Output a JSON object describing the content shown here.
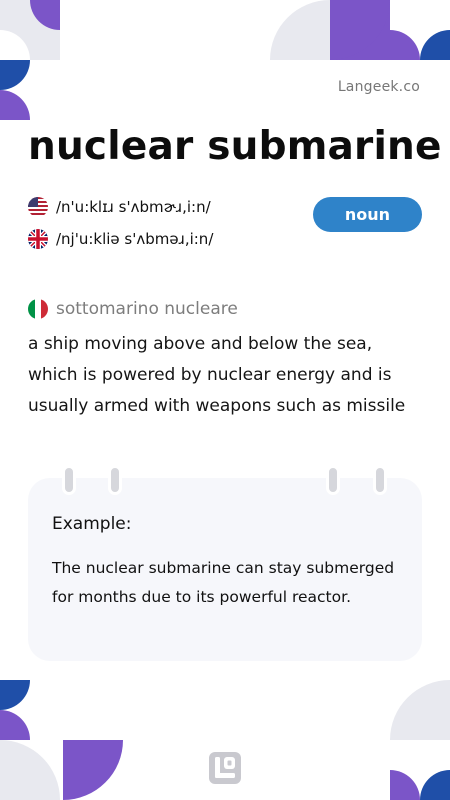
{
  "brand": {
    "label": "Langeek.co"
  },
  "entry": {
    "word": "nuclear submarine",
    "part_of_speech": "noun",
    "pronunciations": [
      {
        "accent": "us-flag",
        "ipa": "/n'u:klɪɹ s'ʌbmɚɹ,i:n/"
      },
      {
        "accent": "uk-flag",
        "ipa": "/nj'u:kliə s'ʌbməɹ,i:n/"
      }
    ],
    "translation": {
      "language": "italy-flag",
      "text": "sottomarino nucleare"
    },
    "definition": "a ship moving above and below the sea, which is powered by nuclear energy and is usually armed with weapons such as missile"
  },
  "example": {
    "title": "Example:",
    "text": "The nuclear submarine can stay submerged for months due to its powerful reactor."
  },
  "colors": {
    "purple": "#7b55c8",
    "blue": "#1f4fa8",
    "light_gray": "#e8e9ef",
    "badge": "#2f83c9"
  }
}
